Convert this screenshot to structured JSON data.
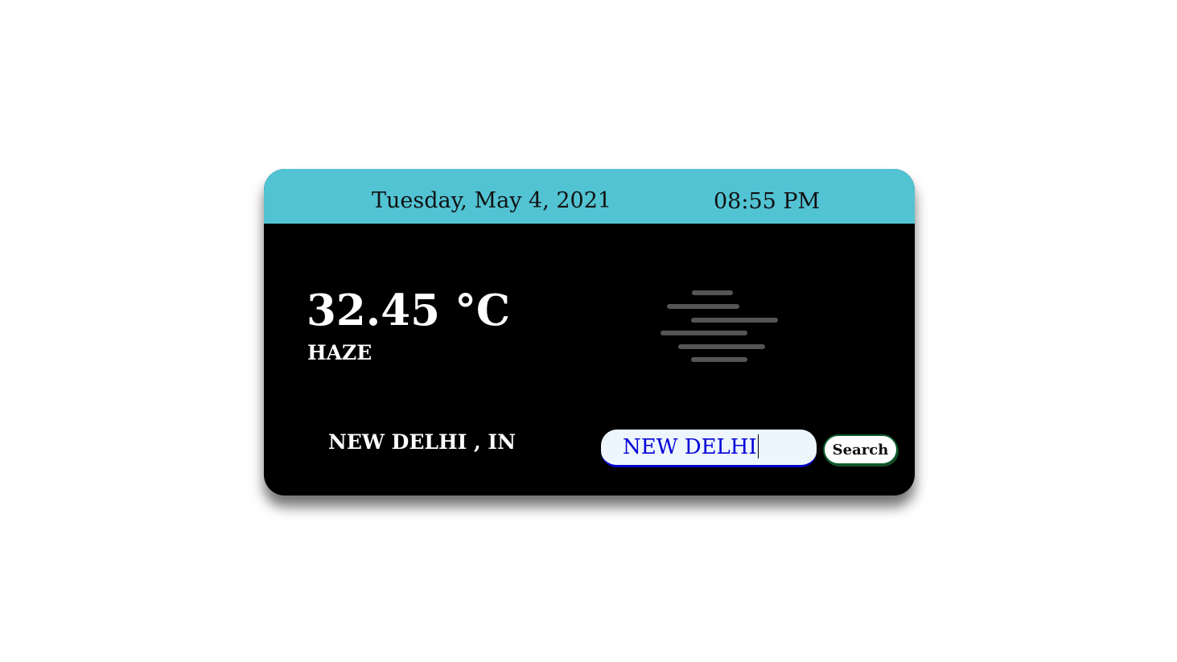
{
  "header": {
    "date": "Tuesday, May 4, 2021",
    "time": "08:55 PM"
  },
  "weather": {
    "temperature": "32.45 °C",
    "condition": "HAZE",
    "icon": "haze-icon"
  },
  "location": {
    "label": "NEW DELHI , IN"
  },
  "search": {
    "value": "NEW DELHI",
    "button_label": "Search"
  },
  "colors": {
    "header_bg": "#52c3d3",
    "card_bg": "#000000",
    "input_text": "#0000d8",
    "input_bg": "#eef6fd",
    "haze_lines": "#555555"
  }
}
